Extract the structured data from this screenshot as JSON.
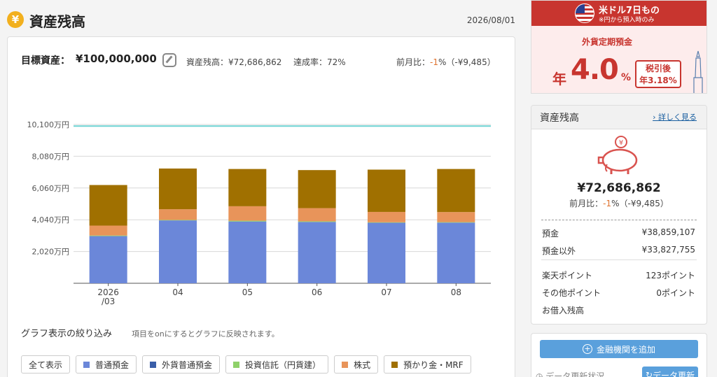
{
  "header": {
    "icon": "yen-coin-icon",
    "title": "資産残高",
    "date": "2026/08/01"
  },
  "summary": {
    "goal_label": "目標資産：",
    "goal_value": "¥100,000,000",
    "balance": "資産残高：¥72,686,862",
    "achievement": "達成率：72%",
    "mom_prefix": "前月比：",
    "mom_pct": "-1",
    "mom_suffix": "%（-¥9,485）"
  },
  "chart_data": {
    "type": "bar",
    "stacked": true,
    "categories": [
      "2026\n/03",
      "04",
      "05",
      "06",
      "07",
      "08"
    ],
    "series": [
      {
        "name": "普通預金",
        "color": "#6b87d9",
        "values": [
          3000,
          4000,
          3930,
          3900,
          3850,
          3860
        ]
      },
      {
        "name": "外貨普通預金",
        "color": "#3a5ea8",
        "values": [
          0,
          0,
          0,
          0,
          0,
          0
        ]
      },
      {
        "name": "投資信託（円貨建）",
        "color": "#8fd16a",
        "values": [
          40,
          30,
          50,
          40,
          30,
          30
        ]
      },
      {
        "name": "株式",
        "color": "#e8945a",
        "values": [
          630,
          680,
          920,
          840,
          660,
          640
        ]
      },
      {
        "name": "預かり金・MRF",
        "color": "#a07000",
        "values": [
          2580,
          2590,
          2370,
          2420,
          2690,
          2740
        ]
      }
    ],
    "goal_line": 10000,
    "yticks": [
      "10,100万円",
      "8,080万円",
      "6,060万円",
      "4,040万円",
      "2,020万円"
    ],
    "ytick_values": [
      10100,
      8080,
      6060,
      4040,
      2020
    ],
    "ylim": [
      0,
      10100
    ],
    "grid": true
  },
  "filter": {
    "title": "グラフ表示の絞り込み",
    "hint": "項目をonにするとグラフに反映されます。",
    "show_all": "全て表示",
    "items": [
      {
        "label": "普通預金",
        "color": "#6b87d9"
      },
      {
        "label": "外貨普通預金",
        "color": "#3a5ea8"
      },
      {
        "label": "投資信託（円貨建）",
        "color": "#8fd16a"
      },
      {
        "label": "株式",
        "color": "#e8945a"
      },
      {
        "label": "預かり金・MRF",
        "color": "#a07000"
      }
    ]
  },
  "banner": {
    "title": "米ドル7日もの",
    "subtitle": "※円から預入時のみ",
    "product": "外貨定期預金",
    "rate_prefix": "年",
    "rate": "4.0",
    "rate_suffix": "%",
    "tax_line1": "税引後",
    "tax_line2": "年3.18%"
  },
  "side": {
    "title": "資産残高",
    "more": "詳しく見る",
    "total": "¥72,686,862",
    "mom_prefix": "前月比：",
    "mom_pct": "-1",
    "mom_suffix": "%（-¥9,485）",
    "deposits_label": "預金",
    "deposits_value": "¥38,859,107",
    "non_deposits_label": "預金以外",
    "non_deposits_value": "¥33,827,755",
    "rakuten_label": "楽天ポイント",
    "rakuten_value": "123ポイント",
    "other_points_label": "その他ポイント",
    "other_points_value": "0ポイント",
    "loan_label": "お借入残高"
  },
  "actions": {
    "add_institution": "金融機関を追加",
    "update_status": "データ更新状況",
    "update_button": "データ更新"
  }
}
